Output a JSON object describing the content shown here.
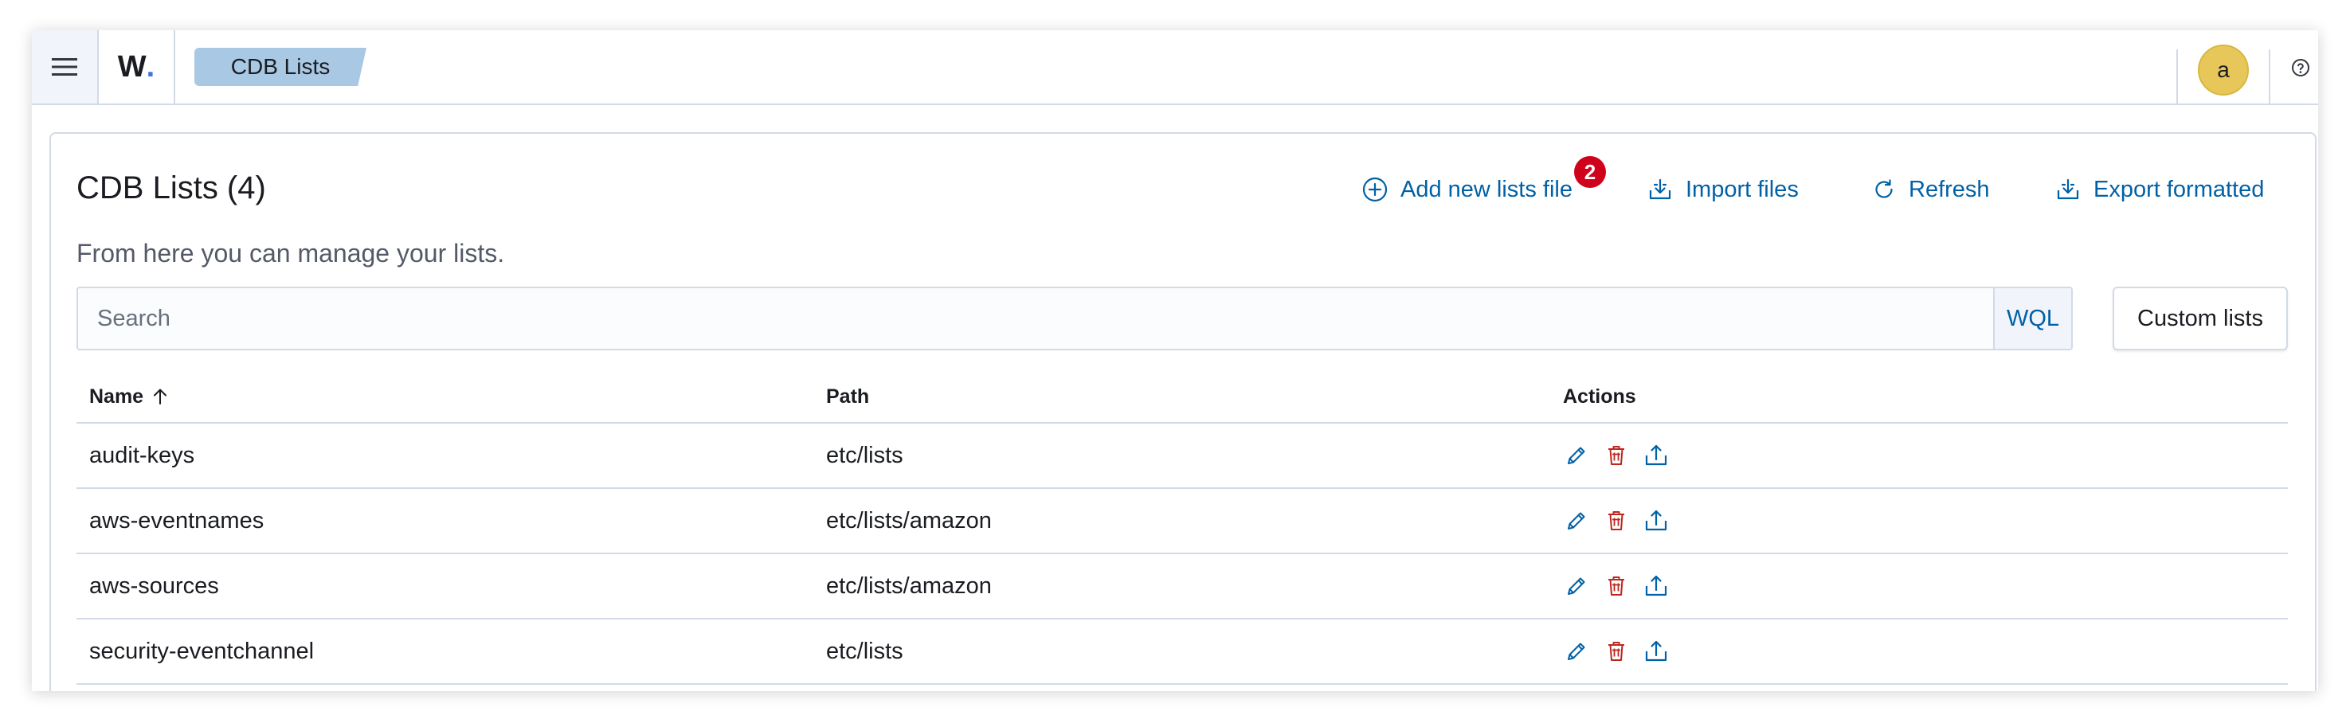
{
  "header": {
    "logo_text": "W",
    "logo_dot": ".",
    "breadcrumb": "CDB Lists",
    "avatar_initial": "a"
  },
  "page": {
    "title": "CDB Lists (4)",
    "description": "From here you can manage your lists."
  },
  "actions": {
    "add_label": "Add new lists file",
    "add_badge": "2",
    "import_label": "Import files",
    "refresh_label": "Refresh",
    "export_label": "Export formatted"
  },
  "search": {
    "placeholder": "Search",
    "wql_label": "WQL",
    "custom_button": "Custom lists"
  },
  "table": {
    "columns": [
      "Name",
      "Path",
      "Actions"
    ],
    "rows": [
      {
        "name": "audit-keys",
        "path": "etc/lists"
      },
      {
        "name": "aws-eventnames",
        "path": "etc/lists/amazon"
      },
      {
        "name": "aws-sources",
        "path": "etc/lists/amazon"
      },
      {
        "name": "security-eventchannel",
        "path": "etc/lists"
      }
    ]
  },
  "colors": {
    "accent": "#0061a6",
    "danger": "#bd271e",
    "badge": "#d0021b",
    "breadcrumb_bg": "#a9c8e4",
    "avatar_bg": "#e7c75a"
  },
  "icons": {
    "menu": "hamburger-icon",
    "help": "help-icon",
    "add": "plus-circle-icon",
    "import": "import-icon",
    "refresh": "refresh-icon",
    "export": "export-icon",
    "sort": "arrow-up-icon",
    "edit": "pencil-icon",
    "delete": "trash-icon",
    "upload": "upload-icon"
  }
}
